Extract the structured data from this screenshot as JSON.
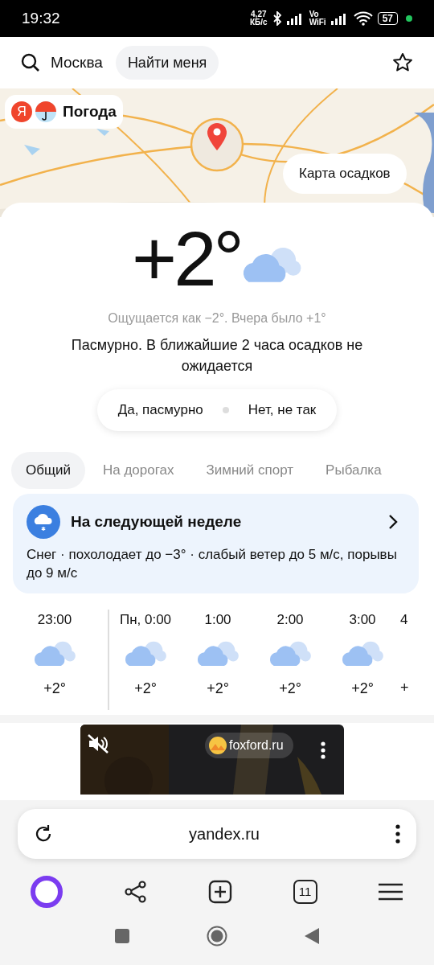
{
  "status_bar": {
    "time": "19:32",
    "net_speed": "4,27\nКБ/с",
    "vowifi": "Vo\nWiFi",
    "battery": "57"
  },
  "header": {
    "city": "Москва",
    "locate_button": "Найти меня"
  },
  "map": {
    "logo_letter": "Я",
    "logo_text": "Погода",
    "precip_button": "Карта осадков"
  },
  "now": {
    "temp": "+2°",
    "feels_like": "Ощущается как −2°. Вчера было +1°",
    "description": "Пасмурно. В ближайшие 2 часа осадков не ожидается",
    "feedback": [
      "Да, пасмурно",
      "Нет, не так"
    ]
  },
  "tabs": [
    {
      "label": "Общий",
      "selected": true
    },
    {
      "label": "На дорогах",
      "selected": false
    },
    {
      "label": "Зимний спорт",
      "selected": false
    },
    {
      "label": "Рыбалка",
      "selected": false
    }
  ],
  "week_card": {
    "title": "На следующей неделе",
    "text": "Снег · похолодает до −3° · слабый ветер до 5 м/с, порывы до 9 м/с"
  },
  "hourly": [
    {
      "time": "23:00",
      "temp": "+2°"
    },
    {
      "time": "Пн, 0:00",
      "temp": "+2°"
    },
    {
      "time": "1:00",
      "temp": "+2°"
    },
    {
      "time": "2:00",
      "temp": "+2°"
    },
    {
      "time": "3:00",
      "temp": "+2°"
    },
    {
      "time": "4",
      "temp": "+"
    }
  ],
  "video": {
    "kind": "picture",
    "source": "foxford.ru"
  },
  "browser": {
    "url": "yandex.ru",
    "tabs_count": "11"
  }
}
